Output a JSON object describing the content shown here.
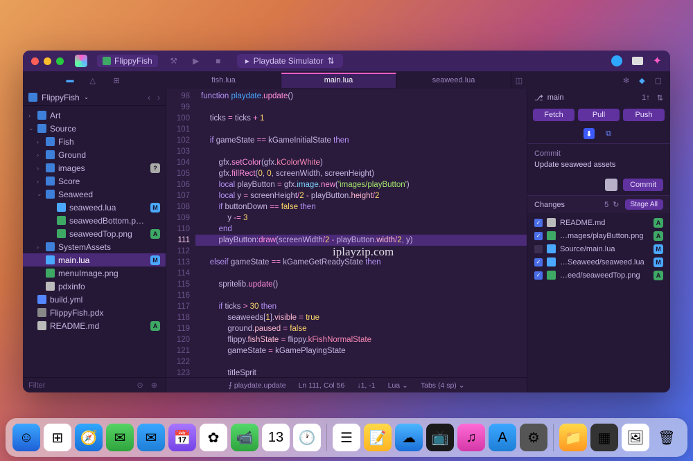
{
  "titlebar": {
    "project": "FlippyFish",
    "simulator": "Playdate Simulator"
  },
  "tabs": [
    "fish.lua",
    "main.lua",
    "seaweed.lua"
  ],
  "activeTab": 1,
  "crumb": "FlippyFish",
  "tree": [
    {
      "chev": "›",
      "icon": "fold",
      "name": "Art",
      "depth": 0
    },
    {
      "chev": "⌄",
      "icon": "fold",
      "name": "Source",
      "depth": 0
    },
    {
      "chev": "›",
      "icon": "fold",
      "name": "Fish",
      "depth": 1
    },
    {
      "chev": "›",
      "icon": "fold",
      "name": "Ground",
      "depth": 1
    },
    {
      "chev": "›",
      "icon": "fold",
      "name": "images",
      "depth": 1,
      "badge": "?",
      "bclass": "bQ"
    },
    {
      "chev": "›",
      "icon": "fold",
      "name": "Score",
      "depth": 1
    },
    {
      "chev": "⌄",
      "icon": "fold",
      "name": "Seaweed",
      "depth": 1
    },
    {
      "chev": "",
      "icon": "lua",
      "name": "seaweed.lua",
      "depth": 2,
      "badge": "M",
      "bclass": "bM"
    },
    {
      "chev": "",
      "icon": "img",
      "name": "seaweedBottom.p…",
      "depth": 2
    },
    {
      "chev": "",
      "icon": "img",
      "name": "seaweedTop.png",
      "depth": 2,
      "badge": "A",
      "bclass": "bA"
    },
    {
      "chev": "›",
      "icon": "fold",
      "name": "SystemAssets",
      "depth": 1
    },
    {
      "chev": "",
      "icon": "lua",
      "name": "main.lua",
      "depth": 1,
      "badge": "M",
      "bclass": "bM",
      "sel": true
    },
    {
      "chev": "",
      "icon": "img",
      "name": "menuImage.png",
      "depth": 1
    },
    {
      "chev": "",
      "icon": "txt",
      "name": "pdxinfo",
      "depth": 1
    },
    {
      "chev": "",
      "icon": "yml",
      "name": "build.yml",
      "depth": 0
    },
    {
      "chev": "",
      "icon": "pdx",
      "name": "FlippyFish.pdx",
      "depth": 0
    },
    {
      "chev": "",
      "icon": "txt",
      "name": "README.md",
      "depth": 0,
      "badge": "A",
      "bclass": "bA"
    }
  ],
  "filter": "Filter",
  "code": {
    "first_line": 98,
    "current_line": 111,
    "lines": [
      "<span class='kw'>function</span> <span class='fn'>playdate</span>.<span class='fn2'>update</span>()",
      "",
      "    ticks <span class='op'>=</span> ticks <span class='op'>+</span> <span class='num'>1</span>",
      "",
      "    <span class='kw'>if</span> gameState <span class='op'>==</span> kGameInitialState <span class='kw'>then</span>",
      "",
      "        gfx.<span class='fn2'>setColor</span>(gfx.<span class='cst'>kColorWhite</span>)",
      "        gfx.<span class='fn2'>fillRect</span>(<span class='num'>0</span>, <span class='num'>0</span>, screenWidth, screenHeight)",
      "        <span class='kw'>local</span> playButton <span class='op'>=</span> gfx.<span class='id'>image</span>.<span class='fn2'>new</span>(<span class='str'>'images/playButton'</span>)",
      "        <span class='kw'>local</span> y <span class='op'>=</span> screenHeight<span class='op'>/</span><span class='num'>2</span> <span class='op'>-</span> playButton.<span class='prop'>height</span><span class='op'>/</span><span class='num'>2</span>",
      "        <span class='kw'>if</span> buttonDown <span class='op'>==</span> <span class='num'>false</span> <span class='kw'>then</span>",
      "            y <span class='op'>-=</span> <span class='num'>3</span>",
      "        <span class='kw'>end</span>",
      "        playButton:<span class='fn2'>draw</span>(screenWidth<span class='op'>/</span><span class='num'>2</span> <span class='op'>-</span> playButton.<span class='prop'>width</span><span class='op'>/</span><span class='num'>2</span>, y)",
      "",
      "    <span class='kw'>elseif</span> gameState <span class='op'>==</span> kGameGetReadyState <span class='kw'>then</span>",
      "",
      "        spritelib.<span class='fn2'>update</span>()",
      "",
      "        <span class='kw'>if</span> ticks <span class='op'>&gt;</span> <span class='num'>30</span> <span class='kw'>then</span>",
      "            seaweeds[<span class='num'>1</span>].<span class='prop'>visible</span> <span class='op'>=</span> <span class='num'>true</span>",
      "            ground.<span class='prop'>paused</span> <span class='op'>=</span> <span class='num'>false</span>",
      "            flippy.<span class='prop'>fishState</span> <span class='op'>=</span> flippy.<span class='cst'>kFishNormalState</span>",
      "            gameState <span class='op'>=</span> kGamePlayingState",
      "",
      "            titleSprit"
    ]
  },
  "status": {
    "symbol": "⨍ playdate.update",
    "pos": "Ln 111, Col 56",
    "enc": "↓1, -1",
    "lang": "Lua",
    "tabs": "Tabs (4 sp)"
  },
  "git": {
    "branch": "main",
    "ahead": "1↑",
    "buttons": [
      "Fetch",
      "Pull",
      "Push"
    ],
    "commit_label": "Commit",
    "commit_msg": "Update seaweed assets",
    "commit_btn": "Commit",
    "changes_label": "Changes",
    "changes_count": "5",
    "stage_btn": "Stage All",
    "changes": [
      {
        "chk": true,
        "icon": "txt",
        "name": "README.md",
        "badge": "A",
        "bclass": "bA"
      },
      {
        "chk": true,
        "icon": "img",
        "name": "…mages/playButton.png",
        "badge": "A",
        "bclass": "bA"
      },
      {
        "chk": false,
        "icon": "lua",
        "name": "Source/main.lua",
        "badge": "M",
        "bclass": "bM"
      },
      {
        "chk": true,
        "icon": "lua",
        "name": "…Seaweed/seaweed.lua",
        "badge": "M",
        "bclass": "bM"
      },
      {
        "chk": true,
        "icon": "img",
        "name": "…eed/seaweedTop.png",
        "badge": "A",
        "bclass": "bA"
      }
    ]
  },
  "watermark": "iplayzip.com",
  "dock": [
    {
      "bg": "linear-gradient(#3ba7ff,#1e5fd6)",
      "g": "☺"
    },
    {
      "bg": "#fff",
      "g": "⊞"
    },
    {
      "bg": "linear-gradient(#2fa8ff,#1a6fd8)",
      "g": "🧭"
    },
    {
      "bg": "linear-gradient(#57d365,#2fa43e)",
      "g": "✉"
    },
    {
      "bg": "linear-gradient(#3ba7ff,#1e7fd6)",
      "g": "✉"
    },
    {
      "bg": "linear-gradient(#a876ff,#7543e6)",
      "g": "📅"
    },
    {
      "bg": "#fff",
      "g": "✿"
    },
    {
      "bg": "linear-gradient(#54d86a,#2fa43e)",
      "g": "📹"
    },
    {
      "bg": "#fff",
      "g": "13"
    },
    {
      "bg": "#fff",
      "g": "🕐"
    },
    {
      "sep": true
    },
    {
      "bg": "#fff",
      "g": "☰"
    },
    {
      "bg": "linear-gradient(#ffd94a,#ffb321)",
      "g": "📝"
    },
    {
      "bg": "linear-gradient(#4cb6ff,#1a6fd8)",
      "g": "☁"
    },
    {
      "bg": "#1a1a1a",
      "g": "📺"
    },
    {
      "bg": "linear-gradient(#ff6bd6,#d438a8)",
      "g": "♫"
    },
    {
      "bg": "linear-gradient(#3ba7ff,#1e7fd6)",
      "g": "A"
    },
    {
      "bg": "#555",
      "g": "⚙"
    },
    {
      "sep": true
    },
    {
      "bg": "linear-gradient(#ffd94a,#ff9821)",
      "g": "📁"
    },
    {
      "bg": "#333",
      "g": "▦"
    },
    {
      "bg": "#fff",
      "g": "🖼"
    },
    {
      "bg": "transparent",
      "g": "🗑"
    }
  ]
}
